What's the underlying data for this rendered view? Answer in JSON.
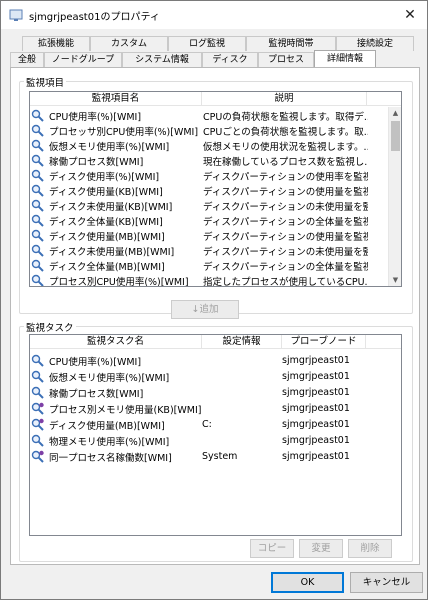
{
  "window": {
    "title": "sjmgrjpeast01のプロパティ",
    "close_symbol": "✕"
  },
  "tabs": {
    "row1": [
      "拡張機能",
      "カスタム",
      "ログ監視",
      "監視時間帯",
      "接続設定"
    ],
    "row2": [
      "全般",
      "ノードグループ",
      "システム情報",
      "ディスク",
      "プロセス",
      "詳細情報"
    ],
    "active": "詳細情報"
  },
  "monitor_items": {
    "group_title": "監視項目",
    "columns": [
      "監視項目名",
      "説明"
    ],
    "rows": [
      {
        "icon": "wmi-magnifier-icon",
        "name": "CPU使用率(%)[WMI]",
        "desc": "CPUの負荷状態を監視します。取得デ..."
      },
      {
        "icon": "wmi-magnifier-icon",
        "name": "プロセッサ別CPU使用率(%)[WMI]",
        "desc": "CPUごとの負荷状態を監視します。取..."
      },
      {
        "icon": "wmi-magnifier-icon",
        "name": "仮想メモリ使用率(%)[WMI]",
        "desc": "仮想メモリの使用状況を監視します。..."
      },
      {
        "icon": "wmi-magnifier-icon",
        "name": "稼働プロセス数[WMI]",
        "desc": "現在稼働しているプロセス数を監視し..."
      },
      {
        "icon": "wmi-magnifier-icon",
        "name": "ディスク使用率(%)[WMI]",
        "desc": "ディスクパーティションの使用率を監視し..."
      },
      {
        "icon": "wmi-magnifier-icon",
        "name": "ディスク使用量(KB)[WMI]",
        "desc": "ディスクパーティションの使用量を監視..."
      },
      {
        "icon": "wmi-magnifier-icon",
        "name": "ディスク未使用量(KB)[WMI]",
        "desc": "ディスクパーティションの未使用量を監..."
      },
      {
        "icon": "wmi-magnifier-icon",
        "name": "ディスク全体量(KB)[WMI]",
        "desc": "ディスクパーティションの全体量を監視..."
      },
      {
        "icon": "wmi-magnifier-icon",
        "name": "ディスク使用量(MB)[WMI]",
        "desc": "ディスクパーティションの使用量を監視..."
      },
      {
        "icon": "wmi-magnifier-icon",
        "name": "ディスク未使用量(MB)[WMI]",
        "desc": "ディスクパーティションの未使用量を監..."
      },
      {
        "icon": "wmi-magnifier-icon",
        "name": "ディスク全体量(MB)[WMI]",
        "desc": "ディスクパーティションの全体量を監視..."
      },
      {
        "icon": "wmi-magnifier-icon",
        "name": "プロセス別CPU使用率(%)[WMI]",
        "desc": "指定したプロセスが使用しているCPU..."
      }
    ],
    "add_button": "↓追加"
  },
  "monitor_tasks": {
    "group_title": "監視タスク",
    "columns": [
      "監視タスク名",
      "設定情報",
      "プローブノード"
    ],
    "rows": [
      {
        "icon": "wmi-magnifier-icon",
        "name": "CPU使用率(%)[WMI]",
        "setting": "",
        "probe": "sjmgrjpeast01"
      },
      {
        "icon": "wmi-magnifier-icon",
        "name": "仮想メモリ使用率(%)[WMI]",
        "setting": "",
        "probe": "sjmgrjpeast01"
      },
      {
        "icon": "wmi-magnifier-icon",
        "name": "稼働プロセス数[WMI]",
        "setting": "",
        "probe": "sjmgrjpeast01"
      },
      {
        "icon": "wmi-magnifier-gear-icon",
        "name": "プロセス別メモリ使用量(KB)[WMI]",
        "setting": "",
        "probe": "sjmgrjpeast01"
      },
      {
        "icon": "wmi-magnifier-gear-icon",
        "name": "ディスク使用量(MB)[WMI]",
        "setting": "C:",
        "probe": "sjmgrjpeast01"
      },
      {
        "icon": "wmi-magnifier-icon",
        "name": "物理メモリ使用率(%)[WMI]",
        "setting": "",
        "probe": "sjmgrjpeast01"
      },
      {
        "icon": "wmi-magnifier-gear-icon",
        "name": "同一プロセス名稼働数[WMI]",
        "setting": "System",
        "probe": "sjmgrjpeast01"
      }
    ],
    "copy_button": "コピー",
    "edit_button": "変更",
    "delete_button": "削除"
  },
  "footer": {
    "ok_button": "OK",
    "cancel_button": "キャンセル"
  },
  "colors": {
    "accent": "#0078d7",
    "icon_blue": "#3b6fb6",
    "icon_purple": "#7d3fa6"
  }
}
